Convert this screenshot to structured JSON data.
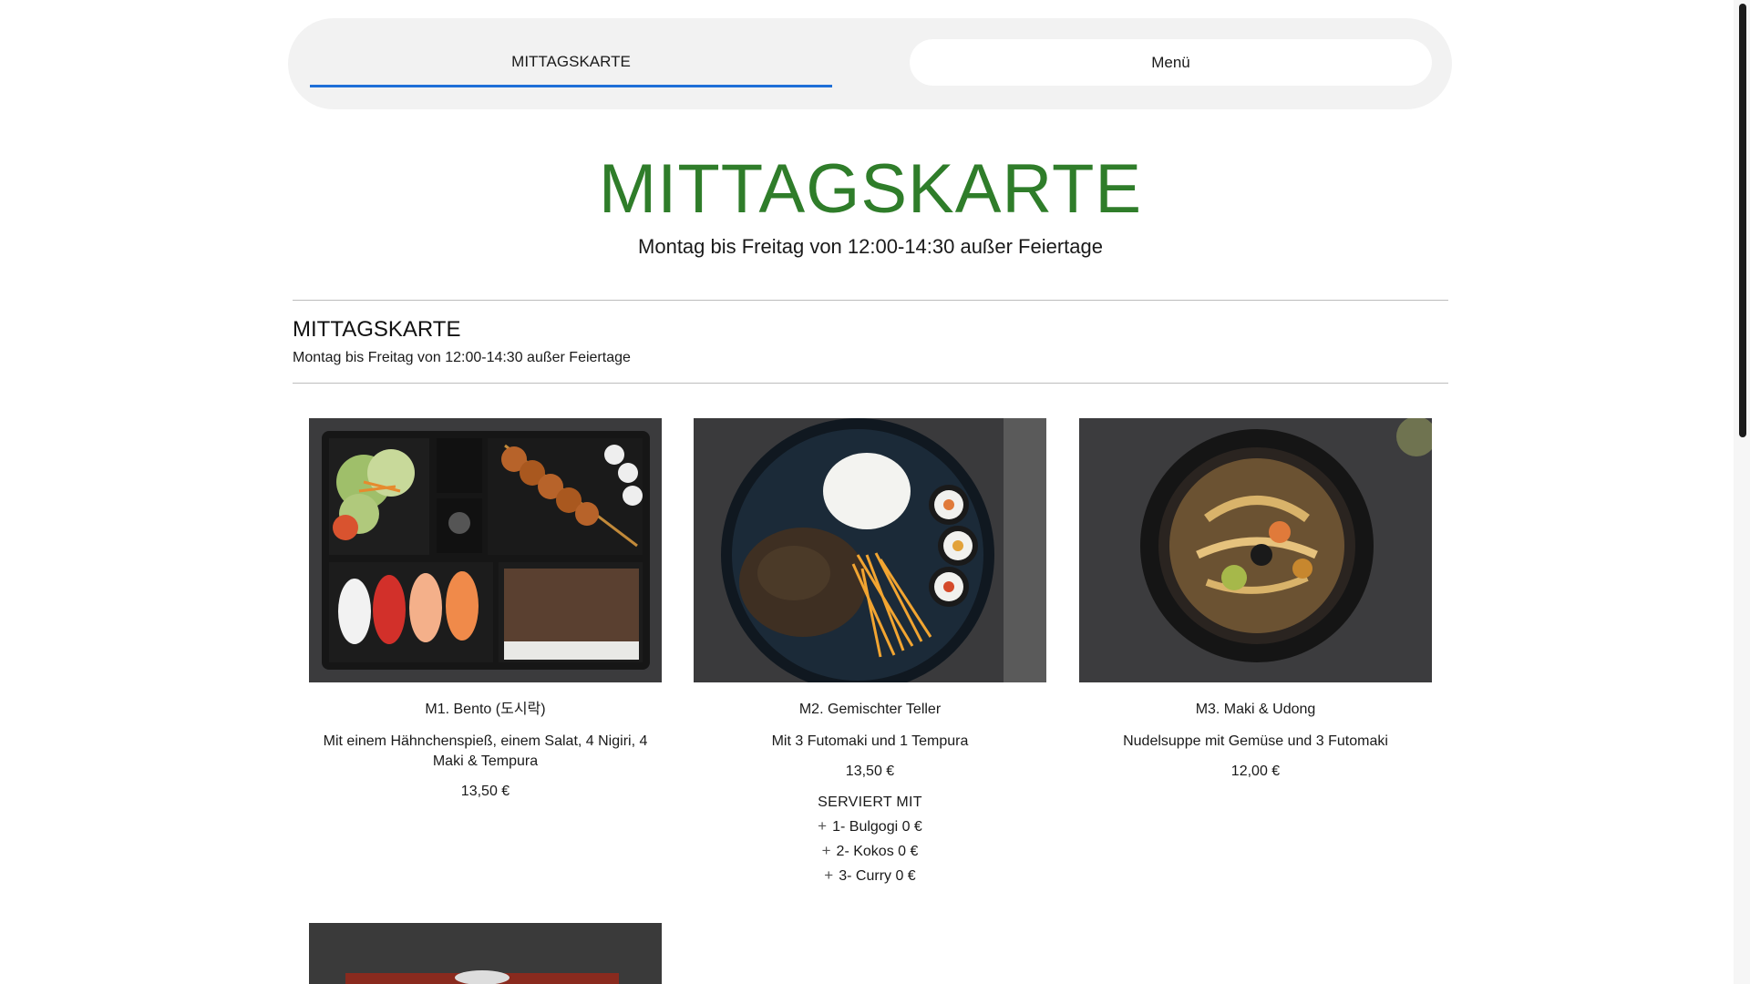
{
  "tabs": [
    {
      "label": "MITTAGSKARTE",
      "active": true
    },
    {
      "label": "Menü",
      "active": false
    }
  ],
  "hero": {
    "title": "MITTAGSKARTE",
    "subtitle": "Montag bis Freitag von 12:00-14:30 außer Feiertage"
  },
  "section": {
    "title": "MITTAGSKARTE",
    "subtitle": "Montag bis Freitag von 12:00-14:30 außer Feiertage"
  },
  "items": [
    {
      "name": "M1. Bento (도시락)",
      "description": "Mit einem Hähnchenspieß, einem Salat, 4 Nigiri, 4 Maki & Tempura",
      "price": "13,50 €"
    },
    {
      "name": "M2. Gemischter Teller",
      "description": "Mit 3 Futomaki und 1 Tempura",
      "price": "13,50 €",
      "served_with_title": "SERVIERT MIT",
      "options": [
        "1- Bulgogi 0 €",
        "2- Kokos 0 €",
        "3- Curry 0 €"
      ]
    },
    {
      "name": "M3. Maki & Udong",
      "description": "Nudelsuppe mit Gemüse und 3 Futomaki",
      "price": "12,00 €"
    }
  ],
  "colors": {
    "accent_green": "#2f7d2a",
    "tab_underline": "#1f6fd8",
    "tabbar_bg": "#f2f2f2"
  }
}
